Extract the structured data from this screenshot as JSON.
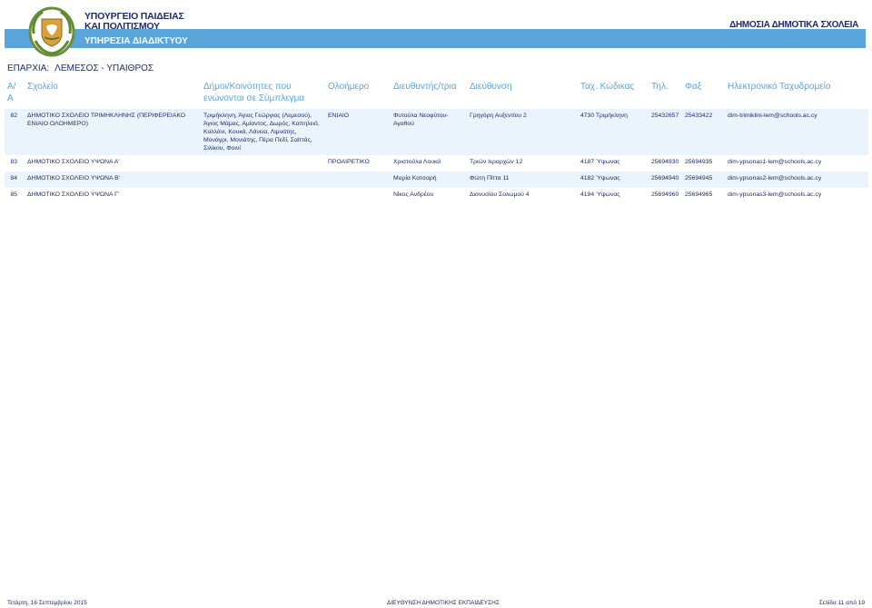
{
  "header": {
    "ministry_line1": "ΥΠΟΥΡΓΕΙΟ ΠΑΙΔΕΙΑΣ",
    "ministry_line2": "ΚΑΙ ΠΟΛΙΤΙΣΜΟΥ",
    "department": "ΥΠΗΡΕΣΙΑ ΔΙΑΔΙΚΤΥΟΥ",
    "brand": "ΔΗΜΟΣΙΑ ΔΗΜΟΤΙΚΑ ΣΧΟΛΕΙΑ",
    "colors": {
      "band": "#5aa5d9",
      "text": "#1f2a6b"
    }
  },
  "region": {
    "label": "ΕΠΑΡΧΙΑ:",
    "value": "ΛΕΜΕΣΟΣ - ΥΠΑΙΘΡΟΣ"
  },
  "table": {
    "columns": [
      "Α/Α",
      "Σχολείο",
      "Δήμοι/Κοινότητες που ενώνονται σε Σύμπλεγμα",
      "Ολοήμερο",
      "Διευθυντής/τρια",
      "Διεύθυνση",
      "Ταχ. Κώδικας",
      "Τηλ.",
      "Φαξ",
      "Ηλεκτρονικό Ταχυδρομείο"
    ],
    "rows": [
      {
        "aa": "82",
        "school": "ΔΗΜΟΤΙΚΟ ΣΧΟΛΕΙΟ ΤΡΙΜΗΚΛΗΝΗΣ (ΠΕΡΙΦΕΡΕΙΑΚΟ ΕΝΙΑΙΟ ΟΛΟΗΜΕΡΟ)",
        "communities": "Τριμήκληνη, Άγιος Γεώργιος (Λεμεσού), Άγιος Μάμας, Αμίαντος, Δωρός, Καπηλειό, Κολλάνι, Κουκά, Λάνεια, Λιμνάτης, Μονάγρι, Μονιάτης, Πέρα Πεδί, Σαϊττάς, Σιλίκου, Φοινί",
        "all_day": "ΕΝΙΑΙΟ",
        "principal": "Φυτούλα Νεοφύτου-Αγαθού",
        "address": "Γρηγόρη Αυξεντίου 2",
        "postal": "4730 Τριμήκληνη",
        "phone": "25432657",
        "fax": "25433422",
        "email": "dim-trimiklini-lem@schools.ac.cy"
      },
      {
        "aa": "83",
        "school": "ΔΗΜΟΤΙΚΟ ΣΧΟΛΕΙΟ ΥΨΩΝΑ Α'",
        "communities": "",
        "all_day": "ΠΡΟΑΙΡΕΤΙΚΟ",
        "principal": "Χριστούλα Λουκά",
        "address": "Τριών Ιεραρχών 12",
        "postal": "4187 Ύψωνας",
        "phone": "25694930",
        "fax": "25694935",
        "email": "dim-ypsonas1-lem@schools.ac.cy"
      },
      {
        "aa": "84",
        "school": "ΔΗΜΟΤΙΚΟ ΣΧΟΛΕΙΟ ΥΨΩΝΑ Β'",
        "communities": "",
        "all_day": "",
        "principal": "Μαρία Κατσαρή",
        "address": "Φώτη Πίττα 11",
        "postal": "4182 Ύψωνας",
        "phone": "25694940",
        "fax": "25694945",
        "email": "dim-ypsonas2-lem@schools.ac.cy"
      },
      {
        "aa": "85",
        "school": "ΔΗΜΟΤΙΚΟ ΣΧΟΛΕΙΟ ΥΨΩΝΑ Γ'",
        "communities": "",
        "all_day": "",
        "principal": "Νίκος Ανδρέου",
        "address": "Διονυσίου Σολωμού 4",
        "postal": "4194 Ύψωνας",
        "phone": "25694960",
        "fax": "25694965",
        "email": "dim-ypsonas3-lem@schools.ac.cy"
      }
    ]
  },
  "footer": {
    "date": "Τετάρτη, 16 Σεπτεμβρίου 2015",
    "department": "ΔΙΕΥΘΥΝΣΗ ΔΗΜΟΤΙΚΗΣ ΕΚΠΑΙΔΕΥΣΗΣ",
    "page": "Σελίδα 11 από 19"
  }
}
